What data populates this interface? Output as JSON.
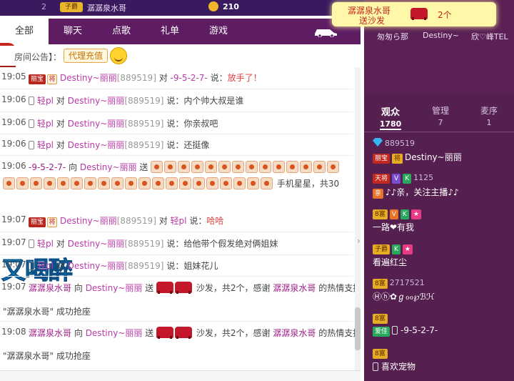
{
  "topbar": {
    "rank": "2",
    "level_badge": "子爵",
    "user_name": "潺潺泉水哥",
    "coins": "210"
  },
  "banner": {
    "line1": "潺潺泉水哥",
    "line2": "送沙发",
    "count": "2个"
  },
  "tabs": [
    {
      "label": "全部"
    },
    {
      "label": "聊天"
    },
    {
      "label": "点歌"
    },
    {
      "label": "礼单"
    },
    {
      "label": "游戏"
    }
  ],
  "notice": {
    "label": "房间公告】：",
    "button": "代理充值"
  },
  "chat": {
    "overlay_text": "又喝醉",
    "messages": [
      {
        "time": "19:05",
        "text_a": "Destiny~丽丽",
        "id": "[889519]",
        "dui": "对",
        "target": "-9-5-2-7-",
        "say": "说：",
        "content": "放手了！"
      },
      {
        "time": "19:06",
        "user": "轻pl",
        "dui": "对",
        "target": "Destiny~丽丽",
        "id": "[889519]",
        "say": "说：",
        "content": "内个帅大叔是谁"
      },
      {
        "time": "19:06",
        "user": "轻pl",
        "dui": "对",
        "target": "Destiny~丽丽",
        "id": "[889519]",
        "say": "说：",
        "content": "你亲叔吧"
      },
      {
        "time": "19:06",
        "user": "轻pl",
        "dui": "对",
        "target": "Destiny~丽丽",
        "id": "[889519]",
        "say": "说：",
        "content": "还挺像"
      },
      {
        "time": "19:06",
        "user": "-9-5-2-7-",
        "xiang": "向",
        "target": "Destiny~丽丽",
        "song": "送",
        "gift_tail": "手机星星，共30"
      },
      {
        "time": "19:07",
        "badge1": "丽宝",
        "badge2": "将",
        "user": "Destiny~丽丽",
        "id": "[889519]",
        "dui": "对",
        "target": "轻pl",
        "say": "说：",
        "content": "哈哈"
      },
      {
        "time": "19:07",
        "user": "轻pl",
        "dui": "对",
        "target": "Destiny~丽丽",
        "id": "[889519]",
        "say": "说：",
        "content": "给他带个假发绝对俩姐妹"
      },
      {
        "time": "19:07",
        "user": "轻pl",
        "dui": "对",
        "target": "Destiny~丽丽",
        "id": "[889519]",
        "say": "说：",
        "content": "姐妹花儿"
      },
      {
        "time": "19:07",
        "user": "潺潺泉水哥",
        "xiang": "向",
        "target": "Destiny~丽丽",
        "song": "送",
        "mid": "沙发，共2个，感谢",
        "thank_user": "潺潺泉水哥",
        "tail": "的热情支持!"
      },
      {
        "system": "\"潺潺泉水哥\" 成功抢座"
      },
      {
        "time": "19:08",
        "user": "潺潺泉水哥",
        "xiang": "向",
        "target": "Destiny~丽丽",
        "song": "送",
        "mid": "沙发，共2个，感谢",
        "thank_user": "潺潺泉水哥",
        "tail": "的热情支持!"
      },
      {
        "system": "\"潺潺泉水哥\" 成功抢座"
      }
    ]
  },
  "right": {
    "avatars": [
      "匆匆ら那",
      "Destiny~",
      "欣♡峰TEL"
    ],
    "tabs": [
      {
        "label": "观众",
        "count": "1780"
      },
      {
        "label": "管理",
        "count": "7"
      },
      {
        "label": "麦序",
        "count": "1"
      }
    ],
    "members": [
      {
        "id": "889519",
        "badge1": "丽宝",
        "badge2": "将",
        "name": "Destiny~丽丽"
      },
      {
        "badge_top": "天将",
        "v": "V",
        "k": "K",
        "id": "1125",
        "badge_bottom": "亲",
        "name": "♪♪亲，关注主播♪♪"
      },
      {
        "badge_top": "8富",
        "v": "V",
        "k": "K",
        "name": "一路❤有我"
      },
      {
        "badge_top": "子爵",
        "k": "K",
        "name": "看遍红尘"
      },
      {
        "badge_top": "8富",
        "id": "2717521",
        "name": "Ⓗⓗ✿ℊℴℴ℘ℬℋ"
      },
      {
        "badge_top": "8富",
        "badge_bottom": "爱佳",
        "name": "-9-5-2-7-"
      },
      {
        "badge_top": "8富",
        "name": "喜欢宠物"
      }
    ]
  }
}
